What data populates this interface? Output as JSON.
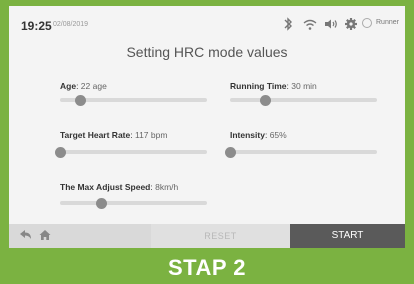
{
  "status": {
    "time": "19:25",
    "date": "02/08/2019",
    "user": "Runner"
  },
  "title": "Setting HRC mode values",
  "settings": {
    "age": {
      "label": "Age",
      "value": "22 age",
      "level": 0.14
    },
    "running_time": {
      "label": "Running Time",
      "value": "30 min",
      "level": 0.24
    },
    "target_hr": {
      "label": "Target Heart Rate",
      "value": "117 bpm",
      "level": 0.0
    },
    "intensity": {
      "label": "Intensity",
      "value": "65%",
      "level": 0.0
    },
    "max_speed": {
      "label": "The Max Adjust Speed",
      "value": "8km/h",
      "level": 0.28
    }
  },
  "buttons": {
    "reset": "RESET",
    "start": "START"
  },
  "caption": "STAP 2",
  "colors": {
    "accent_green": "#7bb241",
    "start_bg": "#5a5a5a",
    "knob": "#8c8c8c",
    "track": "#d9d9d9"
  },
  "icons": [
    "bluetooth-icon",
    "wifi-icon",
    "volume-icon",
    "gear-icon",
    "user-icon",
    "back-icon",
    "home-icon"
  ]
}
